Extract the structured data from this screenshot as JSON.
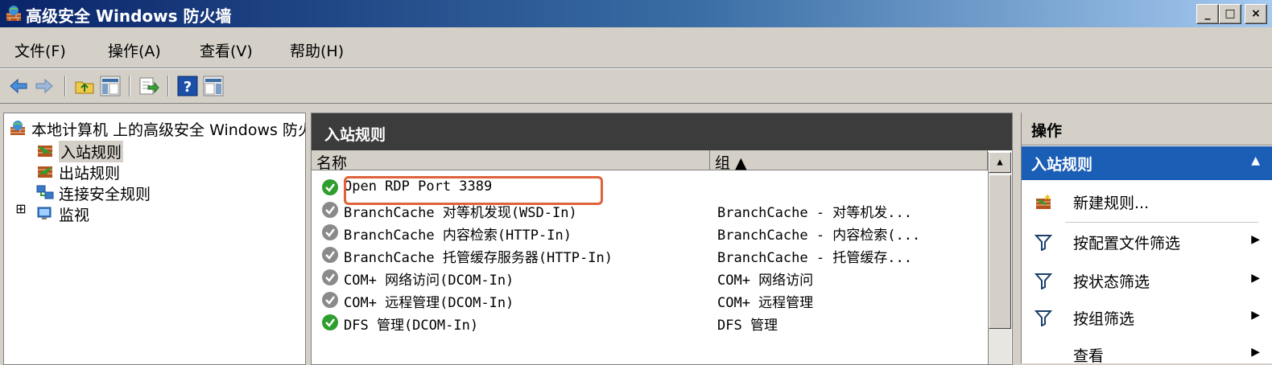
{
  "window": {
    "title": "高级安全 Windows 防火墙",
    "controls": {
      "minimize": "_",
      "maximize": "□",
      "close": "×"
    }
  },
  "menu": [
    "文件(F)",
    "操作(A)",
    "查看(V)",
    "帮助(H)"
  ],
  "toolbar_icons": [
    "back-icon",
    "forward-icon",
    "up-folder-icon",
    "show-hide-tree-icon",
    "export-icon",
    "help-icon",
    "show-hide-action-pane-icon"
  ],
  "tree": {
    "root": "本地计算机 上的高级安全 Windows 防火墙",
    "items": [
      {
        "label": "入站规则",
        "selected": true
      },
      {
        "label": "出站规则",
        "selected": false
      },
      {
        "label": "连接安全规则",
        "selected": false
      },
      {
        "label": "监视",
        "selected": false,
        "expandable": true
      }
    ],
    "expander": "⊞"
  },
  "center": {
    "header": "入站规则",
    "columns": {
      "name": "名称",
      "group": "组 ▲"
    },
    "rules": [
      {
        "name": "Open RDP Port 3389",
        "group": "",
        "enabled": true
      },
      {
        "name": "BranchCache 对等机发现(WSD-In)",
        "group": "BranchCache - 对等机发...",
        "enabled": false
      },
      {
        "name": "BranchCache 内容检索(HTTP-In)",
        "group": "BranchCache - 内容检索(...",
        "enabled": false
      },
      {
        "name": "BranchCache 托管缓存服务器(HTTP-In)",
        "group": "BranchCache - 托管缓存...",
        "enabled": false
      },
      {
        "name": "COM+ 网络访问(DCOM-In)",
        "group": "COM+ 网络访问",
        "enabled": false
      },
      {
        "name": "COM+ 远程管理(DCOM-In)",
        "group": "COM+ 远程管理",
        "enabled": false
      },
      {
        "name": "DFS 管理(DCOM-In)",
        "group": "DFS 管理",
        "enabled": true
      }
    ],
    "scroll_up": "▲"
  },
  "actions": {
    "title": "操作",
    "section": "入站规则",
    "collapse": "▲",
    "items": [
      {
        "label": "新建规则...",
        "icon": "new-rule-icon",
        "submenu": false
      },
      {
        "label": "按配置文件筛选",
        "icon": "filter-icon",
        "submenu": true
      },
      {
        "label": "按状态筛选",
        "icon": "filter-icon",
        "submenu": true
      },
      {
        "label": "按组筛选",
        "icon": "filter-icon",
        "submenu": true
      },
      {
        "label": "查看",
        "icon": "",
        "submenu": true
      }
    ],
    "submenu_arrow": "▶"
  },
  "colors": {
    "enabled_green": "#2e9e2e",
    "disabled_gray": "#8a8a8a",
    "highlight_box": "#e0623a",
    "section_blue": "#1b5eb6"
  }
}
